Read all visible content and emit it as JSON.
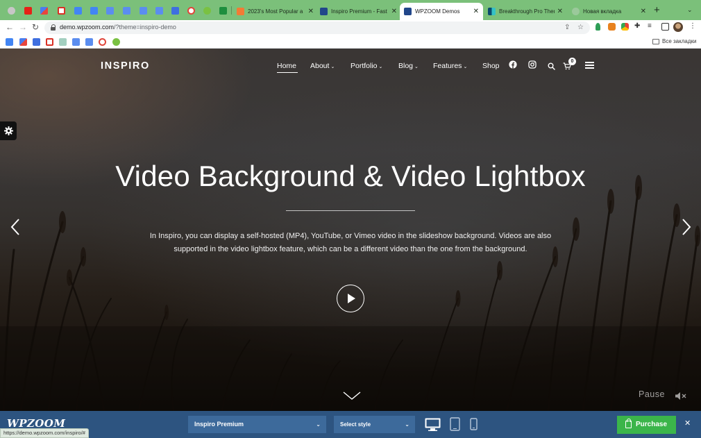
{
  "browser": {
    "pinned_tab_icons": [
      "settings-favicon",
      "youtube-favicon",
      "flag-favicon",
      "gmail-favicon",
      "docs-favicon",
      "docs-favicon",
      "translate-favicon",
      "translate-favicon",
      "translate-favicon",
      "translate-favicon",
      "forms-favicon",
      "copyright-favicon",
      "play-favicon",
      "plus-favicon"
    ],
    "tabs": [
      {
        "title": "2023's Most Popular a",
        "favicon": "orange-favicon",
        "active": false
      },
      {
        "title": "Inspiro Premium - Fast",
        "favicon": "wordpress-favicon",
        "active": false
      },
      {
        "title": "WPZOOM Demos",
        "favicon": "wordpress-favicon",
        "active": true
      },
      {
        "title": "Breakthrough Pro Ther",
        "favicon": "studiopress-favicon",
        "active": false
      },
      {
        "title": "Новая вкладка",
        "favicon": "newtab-favicon",
        "active": false
      }
    ],
    "new_tab_label": "+",
    "url_host": "demo.wpzoom.com",
    "url_path": "/?theme=inspiro-demo",
    "bookmarks_all_label": "Все закладки",
    "status_url": "https://demo.wpzoom.com/inspiro/#"
  },
  "site": {
    "logo": "INSPIRO",
    "menu": [
      {
        "label": "Home",
        "dropdown": false
      },
      {
        "label": "About",
        "dropdown": true
      },
      {
        "label": "Portfolio",
        "dropdown": true
      },
      {
        "label": "Blog",
        "dropdown": true
      },
      {
        "label": "Features",
        "dropdown": true
      },
      {
        "label": "Shop",
        "dropdown": false
      }
    ],
    "caret": "⌄",
    "cart_count": "0",
    "hero_title": "Video Background & Video Lightbox",
    "hero_description": "In Inspiro, you can display a self-hosted (MP4), YouTube, or Vimeo video in the slideshow background. Videos are also supported in the video lightbox feature, which can be a different video than the one from the background.",
    "pause_label": "Pause"
  },
  "demobar": {
    "brand": "WPZOOM",
    "theme_select": "Inspiro Premium",
    "style_select": "Select style",
    "purchase_label": "Purchase",
    "close_label": "✕",
    "devices": [
      "desktop-icon",
      "tablet-icon",
      "mobile-icon"
    ]
  },
  "colors": {
    "tabstrip": "#7bc07a",
    "demobar": "#2d5480",
    "select": "#3d6a9b",
    "purchase": "#3bb54a"
  }
}
